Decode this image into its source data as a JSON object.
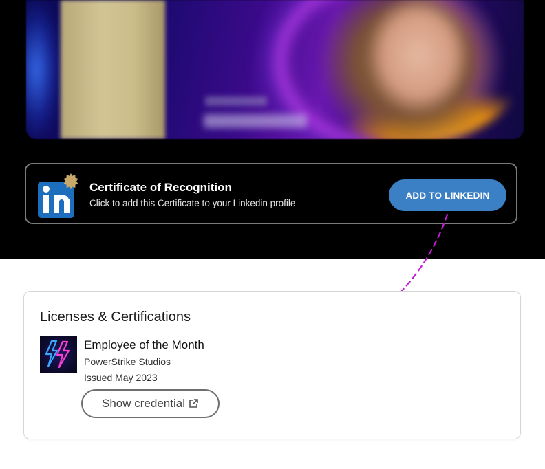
{
  "banner": {
    "title": "Certificate of Recognition",
    "subtitle": "Click to add this Certificate to your Linkedin profile",
    "button_label": "ADD TO LINKEDIN",
    "logo_icon": "linkedin-icon",
    "badge_icon": "seal-badge-icon",
    "button_color": "#3b7fc4",
    "logo_color": "#1d6fbd"
  },
  "licenses": {
    "section_title": "Licenses & Certifications",
    "item": {
      "title": "Employee of the Month",
      "organization": "PowerStrike Studios",
      "issued": "Issued May 2023",
      "thumb_icon": "neon-lightning-icon"
    },
    "show_credential_label": "Show credential",
    "external_icon": "external-link-icon"
  },
  "colors": {
    "dark_background": "#000000",
    "arrow": "#c41ed6",
    "neon_pink": "#ff3fd2",
    "neon_blue": "#3aa6ff"
  }
}
